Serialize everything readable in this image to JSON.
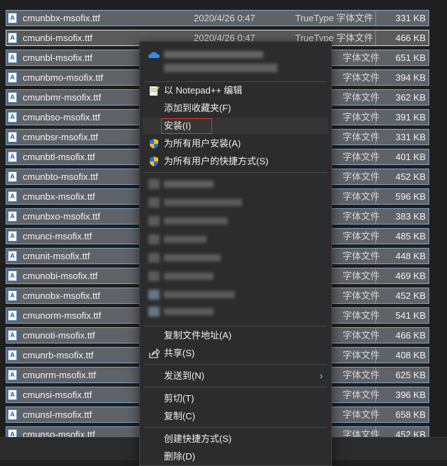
{
  "files": [
    {
      "name": "cmunbbx-msofix.ttf",
      "date": "2020/4/26 0:47",
      "type": "TrueType 字体文件",
      "size": "331 KB"
    },
    {
      "name": "cmunbi-msofix.ttf",
      "date": "2020/4/26 0:47",
      "type": "TrueType 字体文件",
      "size": "466 KB"
    },
    {
      "name": "cmunbl-msofix.ttf",
      "date": "",
      "type": "字体文件",
      "size": "651 KB"
    },
    {
      "name": "cmunbmo-msofix.ttf",
      "date": "",
      "type": "字体文件",
      "size": "394 KB"
    },
    {
      "name": "cmunbmr-msofix.ttf",
      "date": "",
      "type": "字体文件",
      "size": "362 KB"
    },
    {
      "name": "cmunbso-msofix.ttf",
      "date": "",
      "type": "字体文件",
      "size": "391 KB"
    },
    {
      "name": "cmunbsr-msofix.ttf",
      "date": "",
      "type": "字体文件",
      "size": "331 KB"
    },
    {
      "name": "cmunbtl-msofix.ttf",
      "date": "",
      "type": "字体文件",
      "size": "401 KB"
    },
    {
      "name": "cmunbto-msofix.ttf",
      "date": "",
      "type": "字体文件",
      "size": "452 KB"
    },
    {
      "name": "cmunbx-msofix.ttf",
      "date": "",
      "type": "字体文件",
      "size": "596 KB"
    },
    {
      "name": "cmunbxo-msofix.ttf",
      "date": "",
      "type": "字体文件",
      "size": "383 KB"
    },
    {
      "name": "cmunci-msofix.ttf",
      "date": "",
      "type": "字体文件",
      "size": "485 KB"
    },
    {
      "name": "cmunit-msofix.ttf",
      "date": "",
      "type": "字体文件",
      "size": "448 KB"
    },
    {
      "name": "cmunobi-msofix.ttf",
      "date": "",
      "type": "字体文件",
      "size": "469 KB"
    },
    {
      "name": "cmunobx-msofix.ttf",
      "date": "",
      "type": "字体文件",
      "size": "452 KB"
    },
    {
      "name": "cmunorm-msofix.ttf",
      "date": "",
      "type": "字体文件",
      "size": "541 KB"
    },
    {
      "name": "cmunoti-msofix.ttf",
      "date": "",
      "type": "字体文件",
      "size": "466 KB"
    },
    {
      "name": "cmunrb-msofix.ttf",
      "date": "",
      "type": "字体文件",
      "size": "408 KB"
    },
    {
      "name": "cmunrm-msofix.ttf",
      "date": "",
      "type": "字体文件",
      "size": "625 KB"
    },
    {
      "name": "cmunsi-msofix.ttf",
      "date": "",
      "type": "字体文件",
      "size": "396 KB"
    },
    {
      "name": "cmunsl-msofix.ttf",
      "date": "",
      "type": "字体文件",
      "size": "658 KB"
    },
    {
      "name": "cmunso-msofix.ttf",
      "date": "",
      "type": "字体文件",
      "size": "452 KB"
    }
  ],
  "file_icon_glyph": "A",
  "menu": {
    "notepad": "以 Notepad++ 编辑",
    "favorite": "添加到收藏夹(F)",
    "install": "安装(I)",
    "install_all": "为所有用户安装(A)",
    "shortcut_all": "为所有用户的快捷方式(S)",
    "copy_path": "复制文件地址(A)",
    "share": "共享(S)",
    "send_to": "发送到(N)",
    "send_to_arrow": "›",
    "cut": "剪切(T)",
    "copy": "复制(C)",
    "create_shortcut": "创建快捷方式(S)",
    "delete": "删除(D)"
  },
  "colors": {
    "row_bg": "#5f6368",
    "row_border": "#7fa5c4",
    "menu_bg": "#2c2c2c",
    "install_highlight": "#e0312c",
    "onedrive_blue": "#2f8ff0",
    "shield_blue": "#2b6fd6",
    "shield_yellow": "#f2c21b"
  }
}
